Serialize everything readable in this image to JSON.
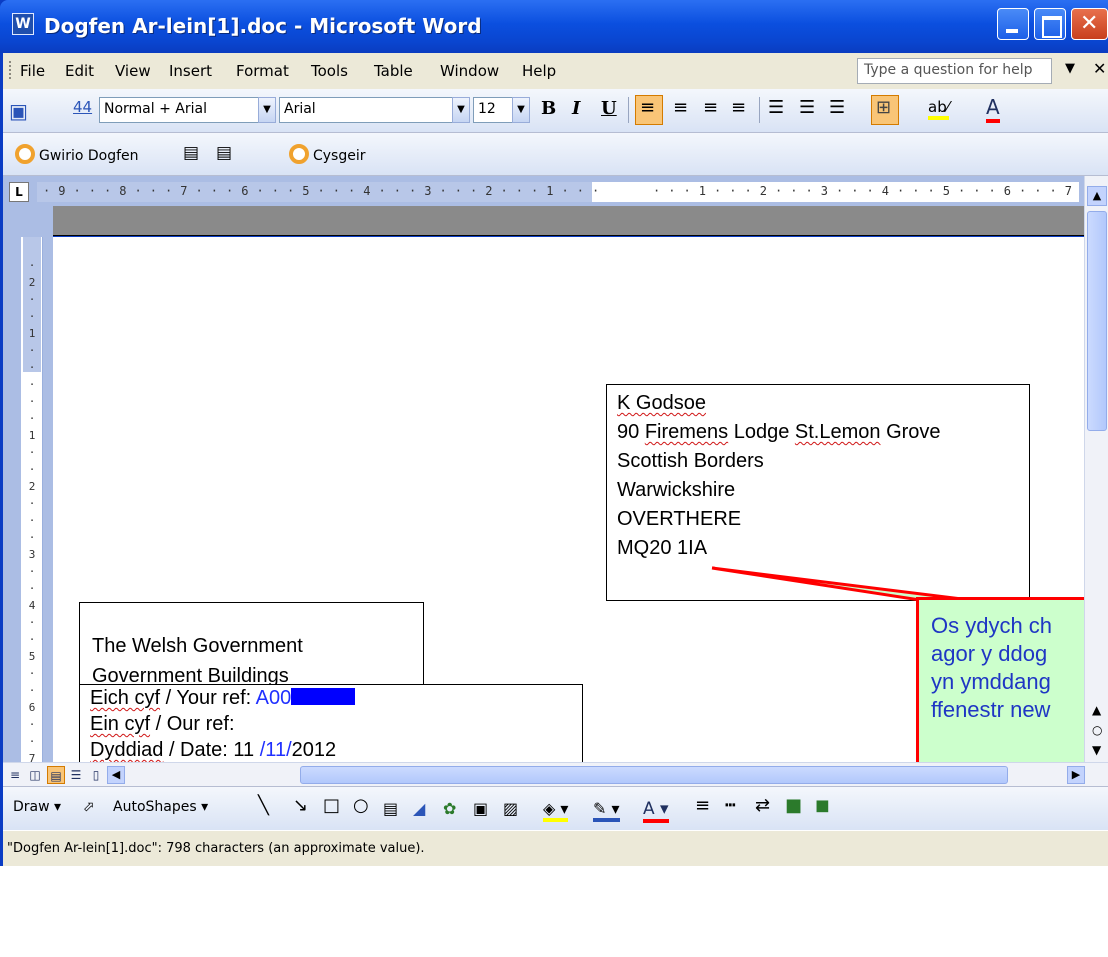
{
  "window": {
    "title": "Dogfen Ar-lein[1].doc - Microsoft Word",
    "app_icon": "word-icon"
  },
  "menu": {
    "items": [
      "File",
      "Edit",
      "View",
      "Insert",
      "Format",
      "Tools",
      "Table",
      "Window",
      "Help"
    ],
    "help_placeholder": "Type a question for help"
  },
  "format_toolbar": {
    "style": "Normal + Arial",
    "font": "Arial",
    "size": "12",
    "bold": "B",
    "italic": "I",
    "underline": "U",
    "style_icon": "44"
  },
  "welsh_toolbar": {
    "gwirio": "Gwirio Dogfen",
    "cysgeir": "Cysgeir"
  },
  "ruler": {
    "text": "· 9 · · · 8 · · · 7 · · · 6 · · · 5 · · · 4 · · · 3 · · · 2 · · · 1 · · ·       · · · 1 · · · 2 · · · 3 · · · 4 · · · 5 · · · 6 · · · 7 · · · 8"
  },
  "document": {
    "address": {
      "name": "K Godsoe",
      "line1_prefix": "90 ",
      "line1_sq1": "Firemens",
      "line1_mid": " Lodge ",
      "line1_sq2": "St.Lemon",
      "line1_suffix": " Grove",
      "line2": "Scottish Borders",
      "line3": "Warwickshire",
      "line4": "OVERTHERE",
      "postcode": "MQ20 1IA"
    },
    "sender": {
      "line1": "The Welsh Government",
      "line2": "Government Buildings"
    },
    "reference": {
      "your_ref_welsh": "Eich cyf",
      "your_ref_label": " / Your ref: ",
      "your_ref_value": "A00",
      "our_ref_welsh": "Ein cyf",
      "our_ref_label": " / Our ref:",
      "date_welsh": "Dyddiad",
      "date_label": " / Date: 11 ",
      "date_month": "/11/",
      "date_year": "2012"
    },
    "callout": {
      "lines": [
        "Os ydych ch",
        "agor y ddog",
        "yn ymddang",
        "ffenestr new"
      ]
    }
  },
  "draw_toolbar": {
    "draw": "Draw ▾",
    "autoshapes": "AutoShapes ▾"
  },
  "status": {
    "text": "\"Dogfen Ar-lein[1].doc\": 798 characters (an approximate value)."
  },
  "colors": {
    "title_bar": "#0b4fdf",
    "callout_fill": "#ccffcc",
    "callout_border": "#ff0000",
    "callout_text": "#1f36c4",
    "redaction": "#0000ff"
  }
}
